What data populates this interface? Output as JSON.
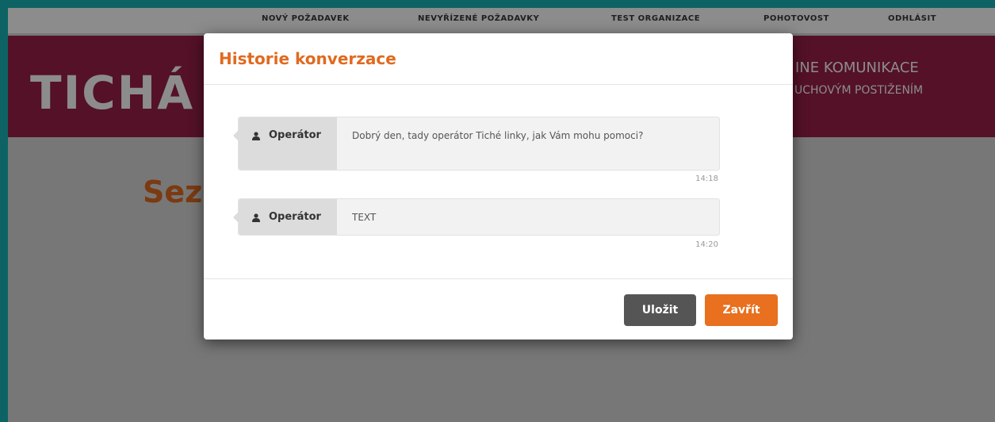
{
  "nav": {
    "items": [
      "NOVÝ POŽADAVEK",
      "NEVYŘÍZENÉ POŽADAVKY",
      "TEST ORGANIZACE",
      "POHOTOVOST",
      "ODHLÁSIT"
    ]
  },
  "banner": {
    "title": "TICHÁ L",
    "tagline_line1": "INE KOMUNIKACE",
    "tagline_line2": "UCHOVÝM POSTIŽENÍM"
  },
  "page": {
    "heading": "Sez"
  },
  "modal": {
    "title": "Historie konverzace",
    "messages": [
      {
        "sender": "Operátor",
        "sender_icon": "user-icon",
        "text": "Dobrý den, tady operátor Tiché linky, jak Vám mohu pomoci?",
        "time": "14:18"
      },
      {
        "sender": "Operátor",
        "sender_icon": "user-icon",
        "text": "TEXT",
        "time": "14:20"
      }
    ],
    "buttons": {
      "save_label": "Uložit",
      "close_label": "Zavřít"
    }
  },
  "colors": {
    "accent_orange": "#e8701e",
    "banner_maroon": "#9a1f47",
    "frame_teal": "#18b4b4"
  }
}
